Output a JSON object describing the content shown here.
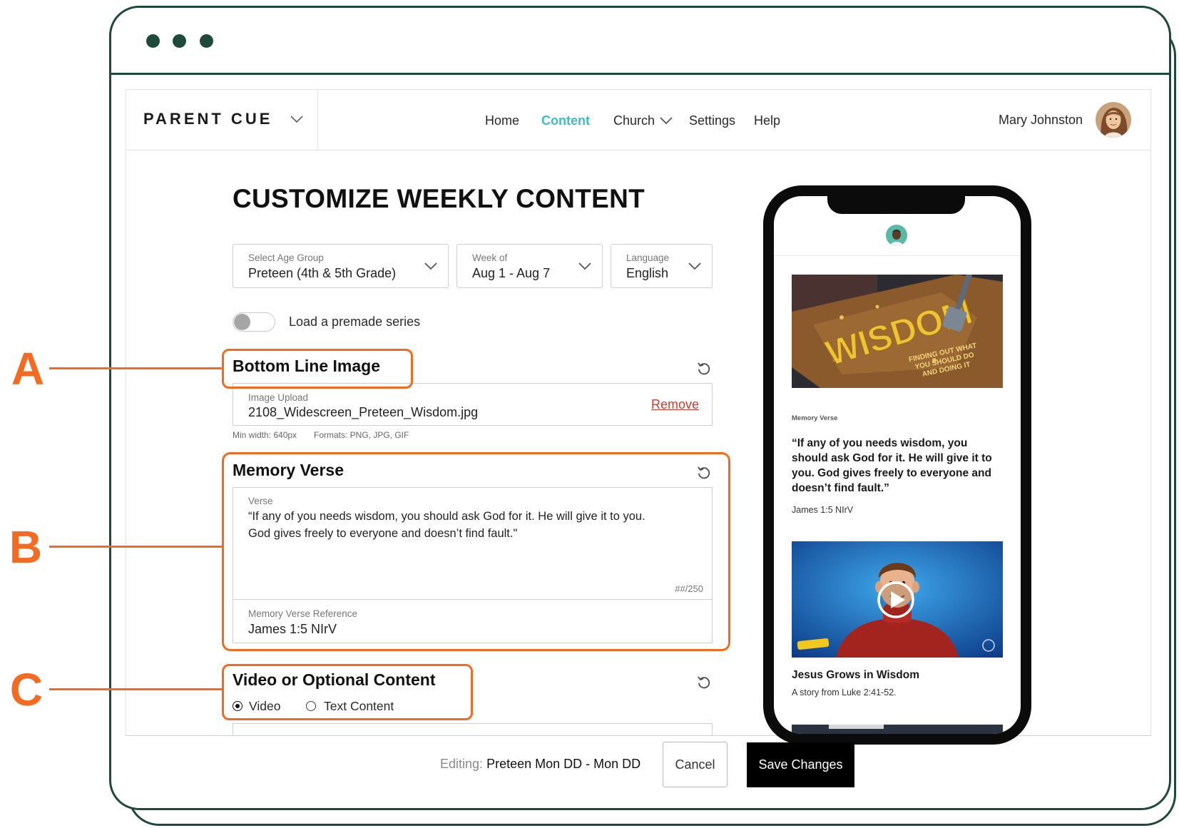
{
  "colors": {
    "frame": "#1f4a3b",
    "accent": "#3dbdc8",
    "annotation": "#f26b21",
    "remove_link": "#d8392c",
    "save_button": "#000000"
  },
  "icons": {
    "dropdown": "chevron-down-icon",
    "reset": "reset-icon",
    "play": "play-icon"
  },
  "callouts": {
    "a": "A",
    "b": "B",
    "c": "C"
  },
  "header": {
    "logo": "PARENT CUE",
    "nav": [
      {
        "label": "Home",
        "active": false
      },
      {
        "label": "Content",
        "active": true
      },
      {
        "label": "Church",
        "active": false,
        "has_menu": true
      },
      {
        "label": "Settings",
        "active": false
      },
      {
        "label": "Help",
        "active": false
      }
    ],
    "user_name": "Mary Johnston"
  },
  "page_title": "CUSTOMIZE WEEKLY CONTENT",
  "filters": {
    "age_group": {
      "label": "Select Age Group",
      "value": "Preteen (4th & 5th Grade)"
    },
    "week": {
      "label": "Week of",
      "value": "Aug 1 - Aug 7"
    },
    "language": {
      "label": "Language",
      "value": "English"
    }
  },
  "premade_toggle": {
    "label": "Load a premade series",
    "on": false
  },
  "bottom_line_image": {
    "heading": "Bottom Line Image",
    "upload_label": "Image Upload",
    "file_name": "2108_Widescreen_Preteen_Wisdom.jpg",
    "remove_label": "Remove",
    "min_width": "Min width: 640px",
    "formats": "Formats: PNG, JPG, GIF"
  },
  "memory_verse": {
    "heading": "Memory Verse",
    "verse_label": "Verse",
    "verse_text": "“If any of you needs wisdom, you should ask God for it. He will give it to you.\nGod gives freely to everyone and doesn’t find fault.\"",
    "counter": "##/250",
    "reference_label": "Memory Verse Reference",
    "reference_value": "James 1:5 NIrV"
  },
  "video_section": {
    "heading": "Video or Optional Content",
    "options": [
      {
        "label": "Video",
        "selected": true
      },
      {
        "label": "Text Content",
        "selected": false
      }
    ]
  },
  "footer": {
    "editing_label": "Editing:",
    "editing_value": "Preteen Mon DD - Mon DD",
    "cancel_label": "Cancel",
    "save_label": "Save Changes"
  },
  "phone_preview": {
    "artwork": {
      "title": "WISDOM",
      "tagline": [
        "FINDING OUT WHAT",
        "YOU SHOULD DO",
        "AND DOING IT"
      ]
    },
    "memory_verse_label": "Memory Verse",
    "verse_text": "“If any of you needs wisdom, you\nshould ask God for it. He will give it to\nyou. God gives freely to everyone and\ndoesn’t find fault.”",
    "reference": "James 1:5 NIrV",
    "video_title": "Jesus Grows in Wisdom",
    "video_description": "A story from Luke 2:41-52."
  }
}
